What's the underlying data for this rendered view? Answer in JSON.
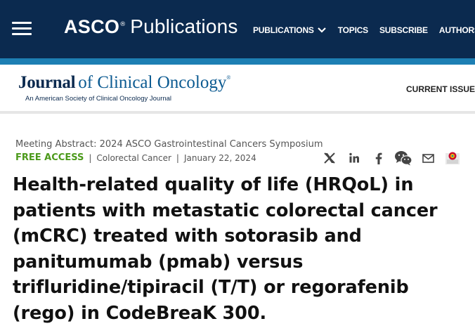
{
  "header": {
    "brand_asco": "ASCO",
    "brand_registered": "®",
    "brand_publications": "Publications",
    "nav": [
      {
        "label": "PUBLICATIONS"
      },
      {
        "label": "TOPICS"
      },
      {
        "label": "SUBSCRIBE"
      },
      {
        "label": "AUTHORS"
      }
    ]
  },
  "journal": {
    "title_first": "Journal",
    "title_rest": "of Clinical Oncology",
    "registered": "®",
    "subtitle": "An American Society of Clinical Oncology Journal",
    "current_issue": "CURRENT ISSUE"
  },
  "article": {
    "meeting": "Meeting Abstract: 2024 ASCO Gastrointestinal Cancers Symposium",
    "access": "FREE ACCESS",
    "category": "Colorectal Cancer",
    "date": "January 22, 2024",
    "title": "Health-related quality of life (HRQoL) in patients with metastatic colorectal cancer (mCRC) treated with sotorasib and panitumumab (pmab) versus trifluridine/tipiracil (T/T) or regorafenib (rego) in CodeBreaK 300."
  },
  "share": [
    "x-icon",
    "linkedin-icon",
    "facebook-icon",
    "wechat-icon",
    "email-icon",
    "mendeley-icon"
  ],
  "colors": {
    "nav_bg": "#0b2a4f",
    "accent_bar": "#1d7fb3",
    "free_access": "#4c9a1b",
    "mendeley": "#c8102e"
  }
}
